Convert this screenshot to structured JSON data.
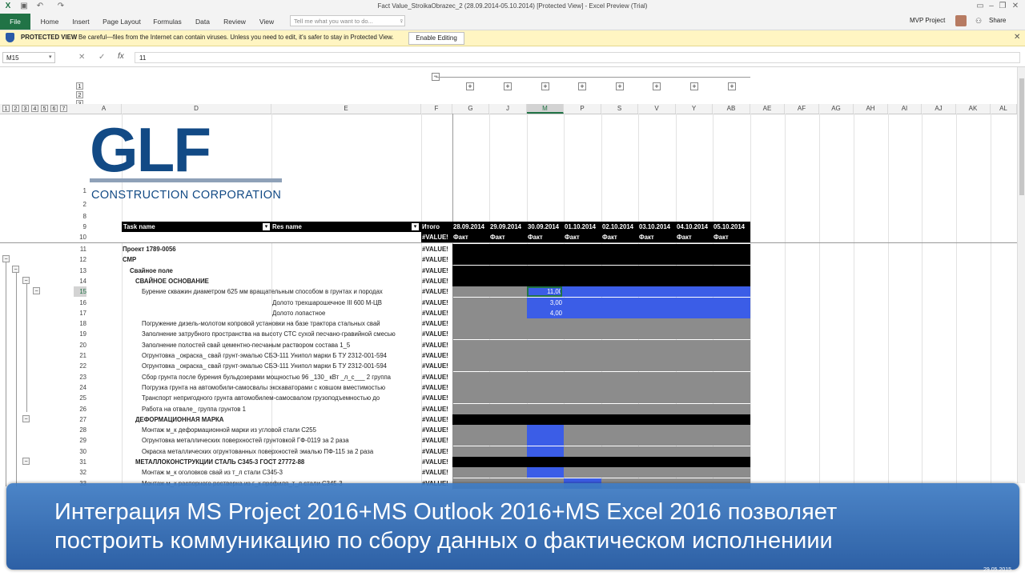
{
  "window": {
    "title": "Fact Value_StroikaObrazec_2 (28.09.2014-05.10.2014)  [Protected View] - Excel Preview (Trial)",
    "user": "MVP Project",
    "share": "Share"
  },
  "ribbon": {
    "tabs": [
      "File",
      "Home",
      "Insert",
      "Page Layout",
      "Formulas",
      "Data",
      "Review",
      "View"
    ],
    "tell_me_placeholder": "Tell me what you want to do..."
  },
  "protected": {
    "label": "PROTECTED VIEW",
    "message": "Be careful—files from the Internet can contain viruses. Unless you need to edit, it's safer to stay in Protected View.",
    "button": "Enable Editing"
  },
  "formula_bar": {
    "name_box": "M15",
    "value": "11"
  },
  "outline_levels": [
    "1",
    "2",
    "3",
    "4",
    "5",
    "6",
    "7"
  ],
  "outline_col_levels": [
    "1",
    "2",
    "3"
  ],
  "columns": [
    "A",
    "D",
    "E",
    "F",
    "G",
    "J",
    "M",
    "P",
    "S",
    "V",
    "Y",
    "AB",
    "AE",
    "AF",
    "AG",
    "AH",
    "AI",
    "AJ",
    "AK",
    "AL"
  ],
  "logo": {
    "text": "GLF",
    "subtitle": "CONSTRUCTION CORPORATION"
  },
  "header_row": {
    "task": "Task name",
    "res": "Res name",
    "total": "Итого",
    "dates": [
      "28.09.2014",
      "29.09.2014",
      "30.09.2014",
      "01.10.2014",
      "02.10.2014",
      "03.10.2014",
      "04.10.2014",
      "05.10.2014"
    ],
    "fact": "Факт"
  },
  "rows": [
    {
      "n": "11",
      "task": "Проект 1789-0056",
      "res": "",
      "total": "#VALUE!"
    },
    {
      "n": "12",
      "task": "СМР",
      "res": "",
      "total": "#VALUE!"
    },
    {
      "n": "13",
      "task": "Свайное поле",
      "res": "",
      "total": "#VALUE!"
    },
    {
      "n": "14",
      "task": "СВАЙНОЕ ОСНОВАНИЕ",
      "res": "",
      "total": "#VALUE!"
    },
    {
      "n": "15",
      "task": "Бурение скважин диаметром 625 мм вращательным способом в грунтах и породах",
      "res": "",
      "total": "#VALUE!",
      "val": "11,00"
    },
    {
      "n": "16",
      "task": "",
      "res": "Долото трехшарошечное III 600 М-ЦВ",
      "total": "#VALUE!",
      "val": "3,00"
    },
    {
      "n": "17",
      "task": "",
      "res": "Долото лопастное",
      "total": "#VALUE!",
      "val": "4,00"
    },
    {
      "n": "18",
      "task": "Погружение дизель-молотом копровой установки на базе трактора стальных свай",
      "res": "",
      "total": "#VALUE!"
    },
    {
      "n": "19",
      "task": "Заполнение затрубного пространства на высоту СТС сухой песчано-гравийной смесью",
      "res": "",
      "total": "#VALUE!"
    },
    {
      "n": "20",
      "task": "Заполнение полостей свай цементно-песчаным раствором состава 1_5",
      "res": "",
      "total": "#VALUE!"
    },
    {
      "n": "21",
      "task": "Огрунтовка _окраска_ свай грунт-эмалью СБЭ-111 Унипол марки Б ТУ 2312-001-594",
      "res": "",
      "total": "#VALUE!"
    },
    {
      "n": "22",
      "task": "Огрунтовка _окраска_ свай грунт-эмалью СБЭ-111 Унипол марки Б ТУ 2312-001-594",
      "res": "",
      "total": "#VALUE!"
    },
    {
      "n": "23",
      "task": "Сбор грунта после бурения бульдозерами мощностью 96 _130_ кВт _л_с___ 2 группа",
      "res": "",
      "total": "#VALUE!"
    },
    {
      "n": "24",
      "task": "Погрузка грунта на автомобили-самосвалы экскаваторами с ковшом вместимостью",
      "res": "",
      "total": "#VALUE!"
    },
    {
      "n": "25",
      "task": "Транспорт непригодного грунта автомобилем-самосвалом грузоподъемностью до",
      "res": "",
      "total": "#VALUE!"
    },
    {
      "n": "26",
      "task": "Работа на отвале_ группа грунтов 1",
      "res": "",
      "total": "#VALUE!"
    },
    {
      "n": "27",
      "task": "ДЕФОРМАЦИОННАЯ МАРКА",
      "res": "",
      "total": "#VALUE!"
    },
    {
      "n": "28",
      "task": "Монтаж м_к деформационной марки из угловой стали С255",
      "res": "",
      "total": "#VALUE!"
    },
    {
      "n": "29",
      "task": "Огрунтовка металлических поверхностей грунтовкой ГФ-0119 за 2 раза",
      "res": "",
      "total": "#VALUE!"
    },
    {
      "n": "30",
      "task": "Окраска металлических огрунтованных поверхностей эмалью ПФ-115 за 2 раза",
      "res": "",
      "total": "#VALUE!"
    },
    {
      "n": "31",
      "task": "МЕТАЛЛОКОНСТРУКЦИИ СТАЛЬ С345-3 ГОСТ 27772-88",
      "res": "",
      "total": "#VALUE!"
    },
    {
      "n": "32",
      "task": "Монтаж м_к оголовков свай из т_л стали С345-3",
      "res": "",
      "total": "#VALUE!"
    },
    {
      "n": "33",
      "task": "Монтаж м_к распорного ростверка из г_к профиля_т_л стали С345-3",
      "res": "",
      "total": "#VALUE!"
    }
  ],
  "banner": {
    "line1": "Интеграция MS Project 2016+MS Outlook 2016+MS Excel 2016 позволяет",
    "line2": "построить коммуникацию по сбору данных о фактическом исполнениии"
  },
  "status": {
    "date": "29.05.2015"
  },
  "colors": {
    "accent": "#217346",
    "blue_fill": "#3b5de7",
    "gray_fill": "#8c8c8c",
    "banner": "#2b65b0"
  }
}
